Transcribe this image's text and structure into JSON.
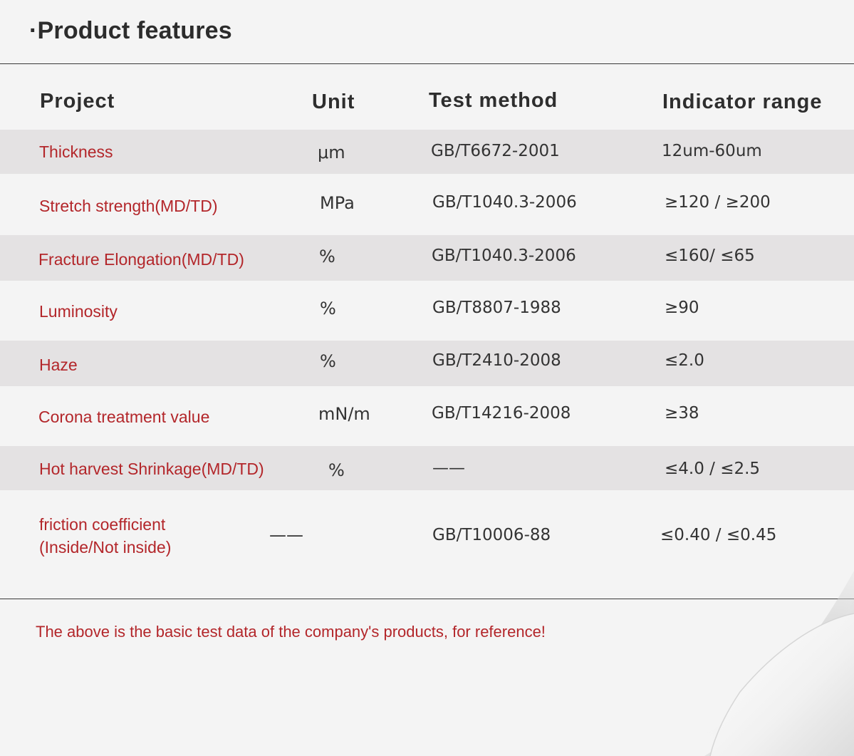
{
  "title": "·Product features",
  "table": {
    "headers": {
      "project": "Project",
      "unit": "Unit",
      "method": "Test method",
      "range": "Indicator range"
    },
    "rows": [
      {
        "project": "Thickness",
        "unit": "μm",
        "method": "GB/T6672-2001",
        "range": "12um-60um"
      },
      {
        "project": "Stretch strength(MD/TD)",
        "unit": "MPa",
        "method": "GB/T1040.3-2006",
        "range": "≥120 / ≥200"
      },
      {
        "project": "Fracture Elongation(MD/TD)",
        "unit": "%",
        "method": "GB/T1040.3-2006",
        "range": "≤160/ ≤65"
      },
      {
        "project": "Luminosity",
        "unit": "%",
        "method": "GB/T8807-1988",
        "range": "≥90"
      },
      {
        "project": "Haze",
        "unit": "%",
        "method": "GB/T2410-2008",
        "range": "≤2.0"
      },
      {
        "project": "Corona treatment value",
        "unit": "mN/m",
        "method": "GB/T14216-2008",
        "range": "≥38"
      },
      {
        "project": "Hot harvest Shrinkage(MD/TD)",
        "unit": "%",
        "method": "——",
        "range": "≤4.0 / ≤2.5"
      },
      {
        "project_line1": "friction coefficient",
        "project_line2": "(Inside/Not inside)",
        "unit": "——",
        "method": "GB/T10006-88",
        "range": "≤0.40 / ≤0.45"
      }
    ]
  },
  "note": "The above is the basic test data of the company's products, for reference!",
  "colors": {
    "accent_red": "#b3262a",
    "text_dark": "#333333",
    "background": "#f4f4f4",
    "row_shade": "#e4e2e3"
  }
}
